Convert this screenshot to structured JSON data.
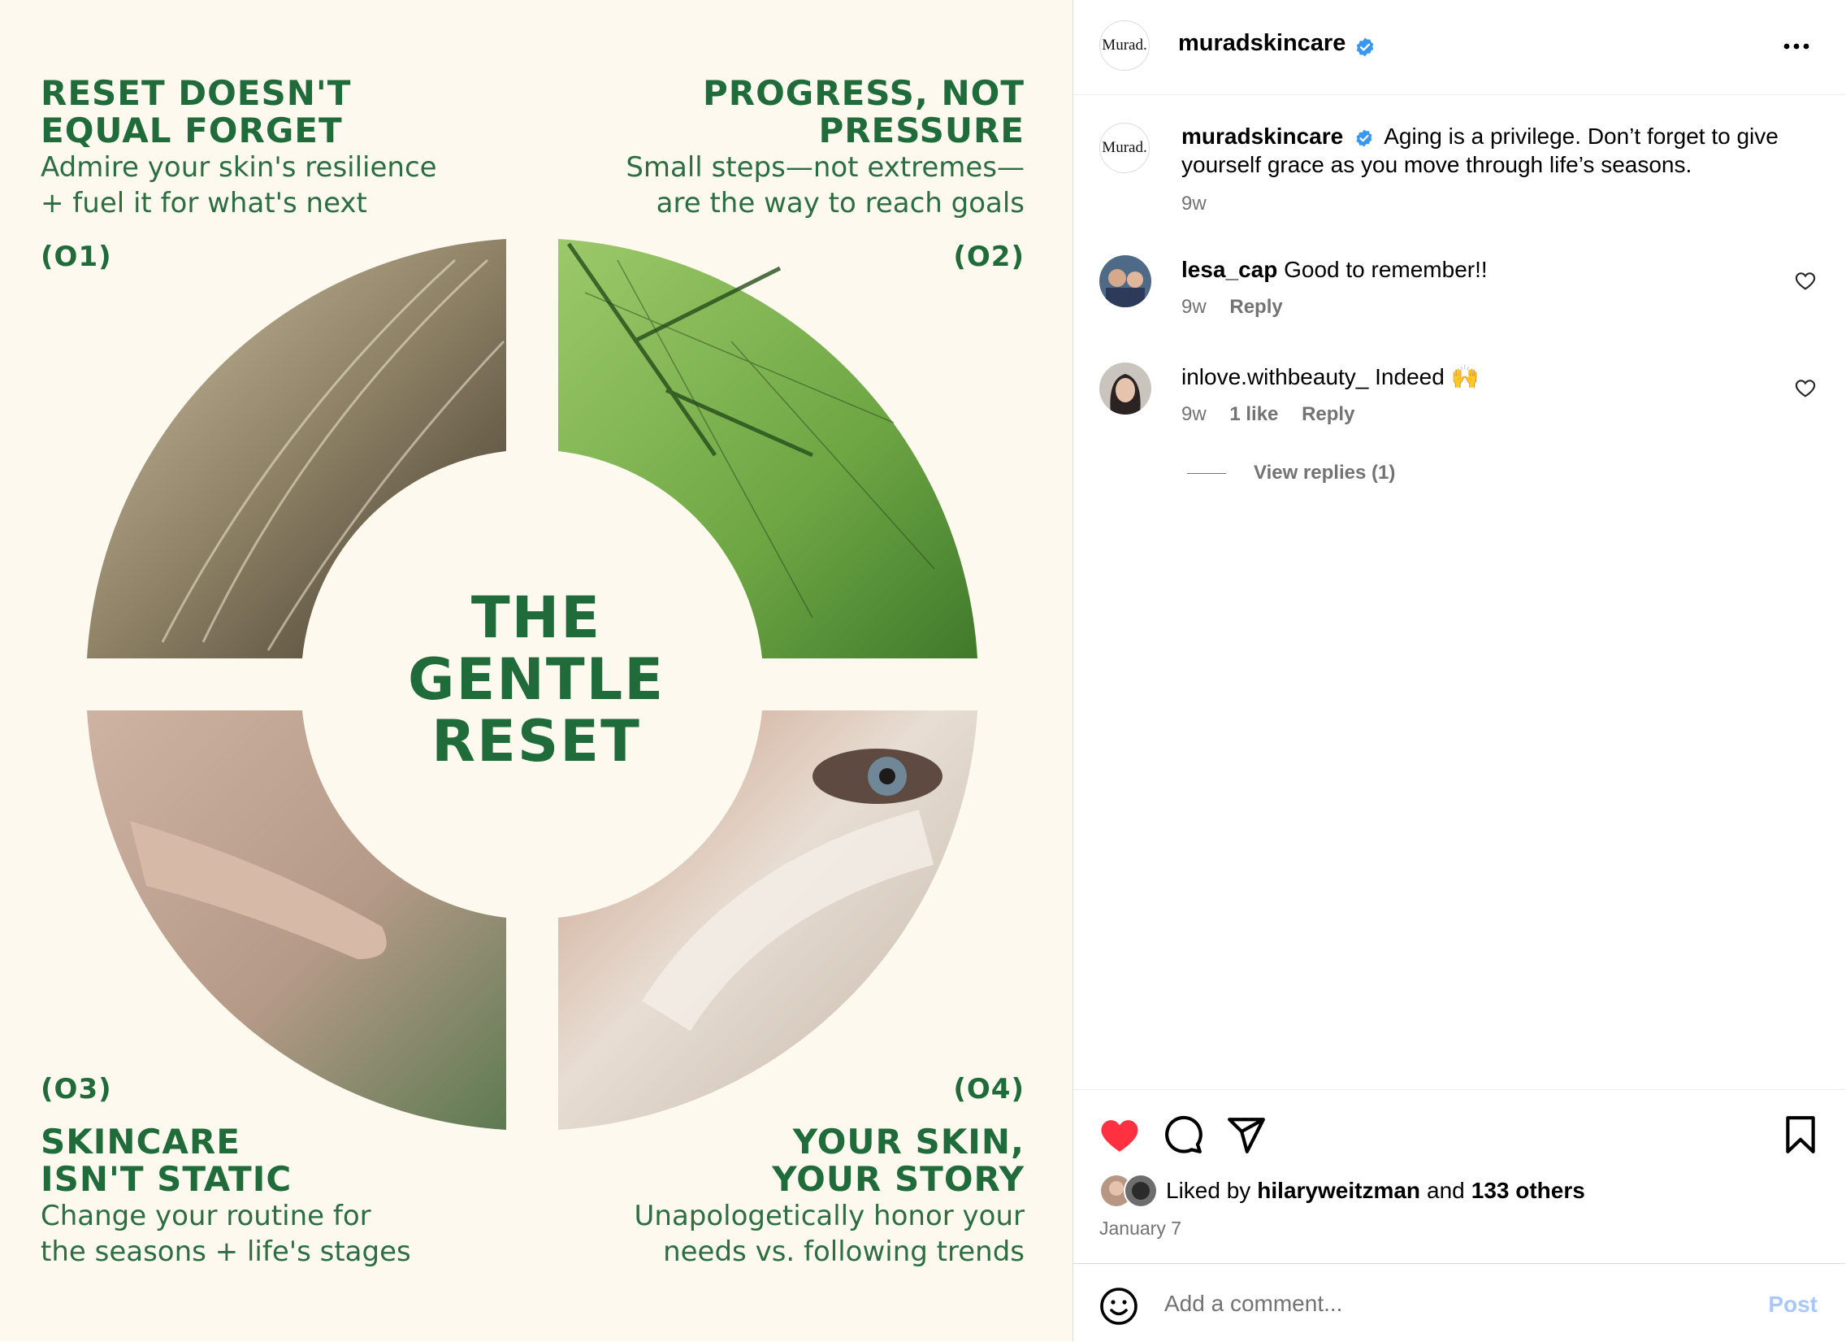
{
  "image": {
    "center_title": "THE\nGENTLE\nRESET",
    "quadrants": [
      {
        "number": "(O1)",
        "title": "RESET DOESN'T\nEQUAL FORGET",
        "subtitle": "Admire your skin's resilience\n+ fuel it for what's next"
      },
      {
        "number": "(O2)",
        "title": "PROGRESS, NOT\nPRESSURE",
        "subtitle": "Small steps—not extremes—\nare the way to reach goals"
      },
      {
        "number": "(O3)",
        "title": "SKINCARE\nISN'T STATIC",
        "subtitle": "Change your routine for\nthe seasons + life's stages"
      },
      {
        "number": "(O4)",
        "title": "YOUR SKIN,\nYOUR STORY",
        "subtitle": "Unapologetically honor your\nneeds vs. following trends"
      }
    ],
    "colors": {
      "background": "#fdf9ef",
      "brand_green": "#1f6b3a"
    }
  },
  "header": {
    "avatar_text": "Murad.",
    "username": "muradskincare",
    "verified_icon": "verified-badge-icon",
    "more_icon": "more-options-icon"
  },
  "caption": {
    "avatar_text": "Murad.",
    "username": "muradskincare",
    "text": "Aging is a privilege. Don’t forget to give yourself grace as you move through life’s seasons.",
    "time": "9w"
  },
  "comments": [
    {
      "username": "lesa_cap",
      "text": "Good to remember!!",
      "time": "9w",
      "likes": "",
      "reply_label": "Reply"
    },
    {
      "username": "inlove.withbeauty_",
      "text": "Indeed 🙌",
      "time": "9w",
      "likes": "1 like",
      "reply_label": "Reply"
    }
  ],
  "view_replies": "View replies (1)",
  "actions": {
    "like_icon": "heart-filled-icon",
    "comment_icon": "comment-bubble-icon",
    "share_icon": "paper-plane-icon",
    "save_icon": "bookmark-icon",
    "liked": true,
    "like_color": "#ff3040"
  },
  "likes": {
    "prefix": "Liked by",
    "user": "hilaryweitzman",
    "joiner": "and",
    "others": "133 others"
  },
  "date": "January 7",
  "comment_box": {
    "placeholder": "Add a comment...",
    "post_label": "Post",
    "emoji_icon": "smiley-icon"
  }
}
